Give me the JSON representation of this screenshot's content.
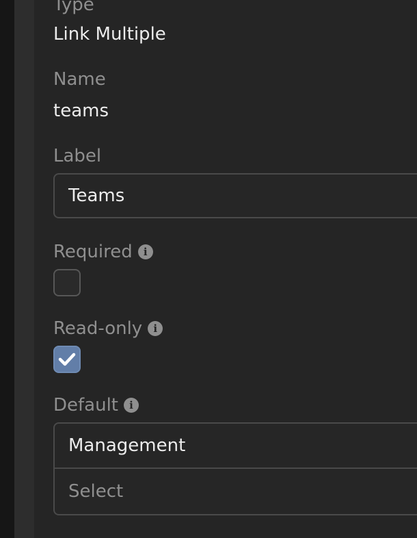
{
  "fields": {
    "type": {
      "label": "Type",
      "value": "Link Multiple"
    },
    "name": {
      "label": "Name",
      "value": "teams"
    },
    "label": {
      "label": "Label",
      "value": "Teams"
    },
    "required": {
      "label": "Required",
      "checked": false
    },
    "readonly": {
      "label": "Read-only",
      "checked": true
    },
    "default": {
      "label": "Default",
      "items": [
        "Management"
      ],
      "select_placeholder": "Select"
    }
  },
  "icons": {
    "info": "info-icon",
    "check": "check-icon"
  },
  "colors": {
    "checkbox_checked": "#627ea8"
  }
}
